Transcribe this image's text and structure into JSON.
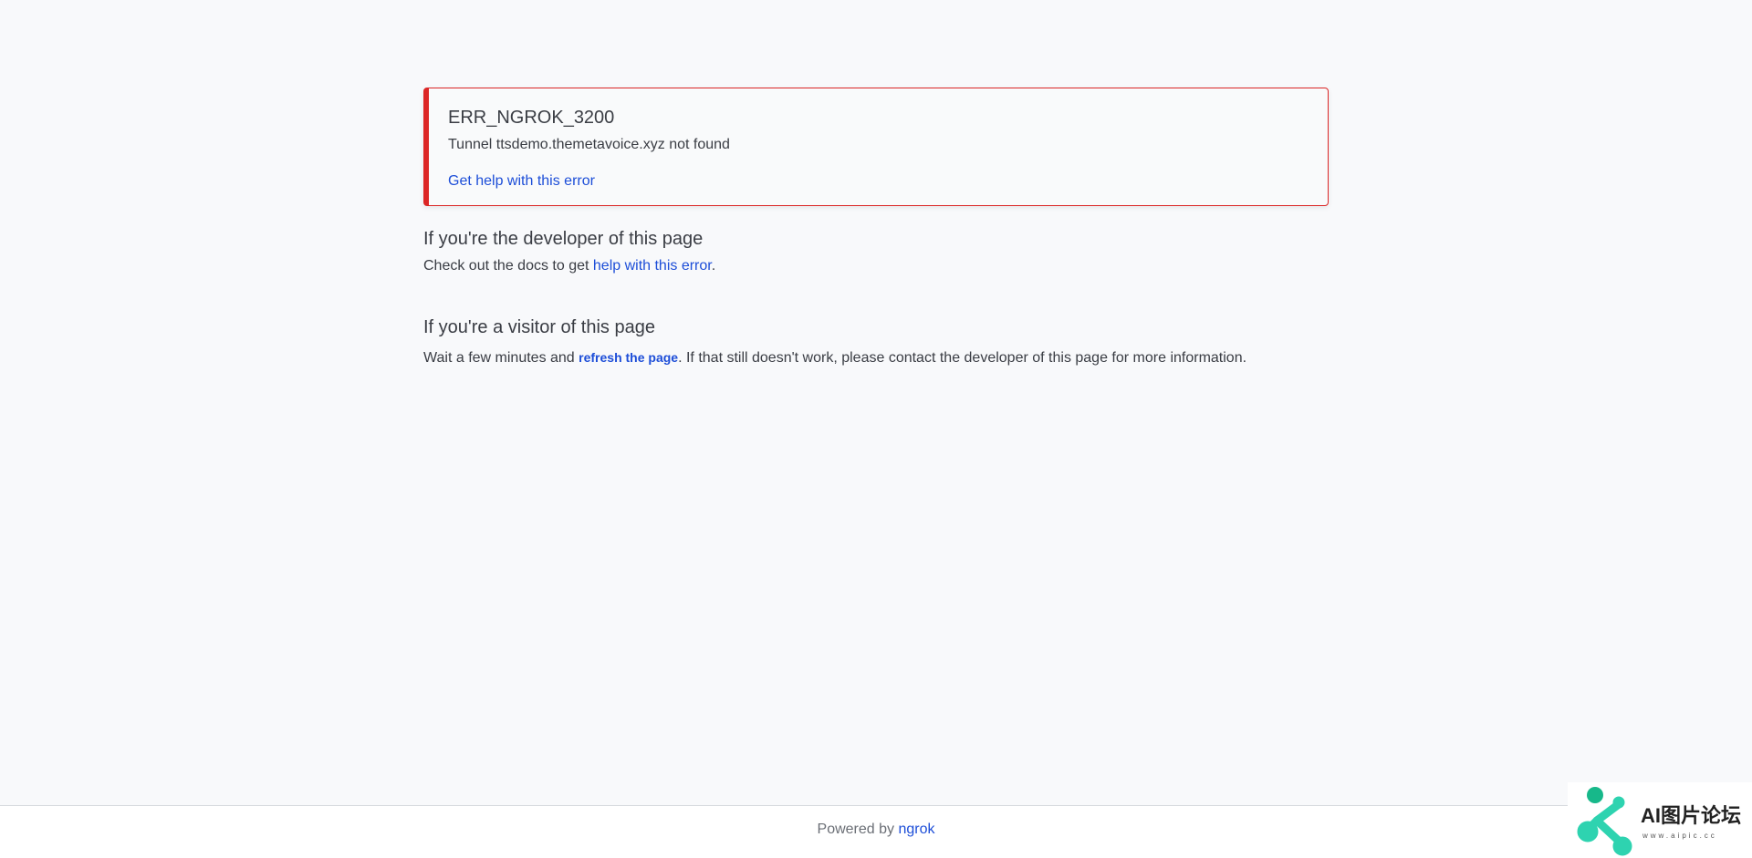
{
  "error": {
    "code": "ERR_NGROK_3200",
    "message": "Tunnel ttsdemo.themetavoice.xyz not found",
    "help_link": "Get help with this error"
  },
  "developer": {
    "heading": "If you're the developer of this page",
    "text_before": "Check out the docs to get ",
    "link": "help with this error",
    "text_after": "."
  },
  "visitor": {
    "heading": "If you're a visitor of this page",
    "text_before": "Wait a few minutes and ",
    "link": "refresh the page",
    "text_after": ". If that still doesn't work, please contact the developer of this page for more information."
  },
  "footer": {
    "prefix": "Powered by ",
    "link": "ngrok"
  },
  "watermark": {
    "title": "AI图片论坛",
    "subtitle": "www.aipic.cc"
  },
  "colors": {
    "accent": "#1d4ed8",
    "error": "#dc2626",
    "watermark": "#2ed3b0"
  }
}
